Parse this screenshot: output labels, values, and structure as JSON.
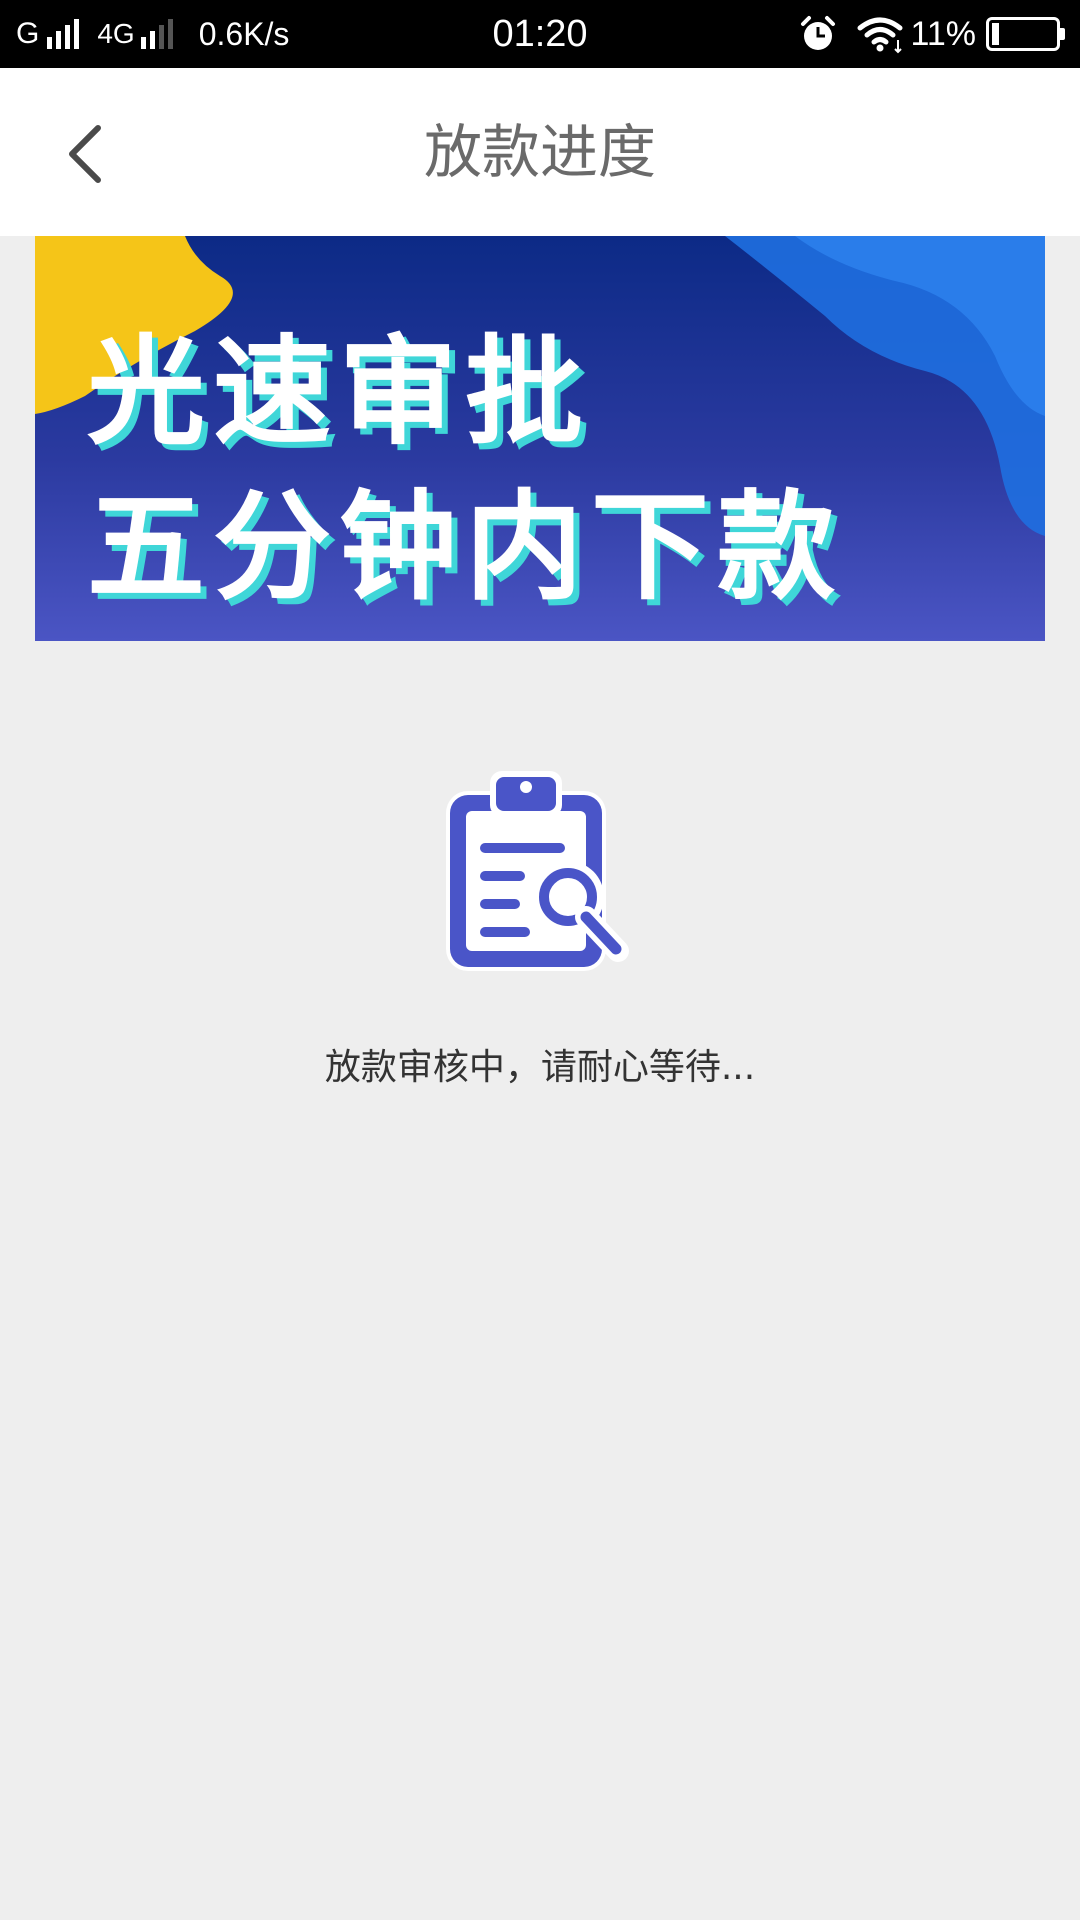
{
  "status_bar": {
    "carrier_1": "G",
    "carrier_2": "4G",
    "network_speed": "0.6K/s",
    "time": "01:20",
    "battery_percent": "11%",
    "battery_level": 0.11,
    "icons": [
      "signal-icon",
      "alarm-icon",
      "wifi-icon",
      "battery-icon"
    ]
  },
  "header": {
    "title": "放款进度",
    "back_icon": "chevron-left-icon"
  },
  "banner": {
    "line_1": "光速审批",
    "line_2": "五分钟内下款",
    "colors": {
      "background_top": "#0c2a86",
      "background_bottom": "#4b55c4",
      "accent_yellow": "#f5c518",
      "accent_blue": "#1f6fe0",
      "text_shadow": "#3fd6d8"
    }
  },
  "status": {
    "icon": "clipboard-search-icon",
    "icon_color": "#4a55c8",
    "message": "放款审核中，请耐心等待..."
  }
}
